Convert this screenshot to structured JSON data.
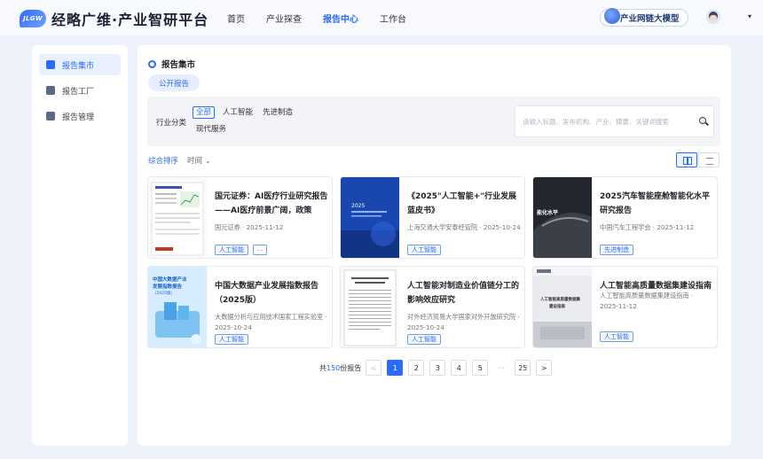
{
  "header": {
    "logo_mark": "JLGW",
    "title": "经略广维·产业智研平台",
    "nav": [
      "首页",
      "产业探查",
      "报告中心",
      "工作台"
    ],
    "ai_model": "产业网链大模型",
    "caret": "▾"
  },
  "sidebar": {
    "items": [
      {
        "label": "报告集市",
        "active": true
      },
      {
        "label": "报告工厂",
        "active": false
      },
      {
        "label": "报告管理",
        "active": false
      }
    ]
  },
  "main": {
    "title": "报告集市",
    "tab": "公开报告",
    "filter": {
      "label": "行业分类",
      "chips": [
        "全部",
        "人工智能",
        "先进制造",
        "现代服务"
      ]
    },
    "search_placeholder": "请输入标题、发布机构、产业、摘要、关键词搜索",
    "sort": {
      "primary": "综合排序",
      "secondary": "时间 ⌄"
    },
    "cards": [
      {
        "title": "国元证券：AI医疗行业研究报告——AI医疗前景广阔，政策助...",
        "meta": "国元证券 · 2025-11-12",
        "tag": "人工智能",
        "more": "..."
      },
      {
        "title": "《2025\"人工智能+\"行业发展蓝皮书》",
        "meta": "上海交通大学安泰经管院 · 2025-10-24",
        "tag": "人工智能"
      },
      {
        "title": "2025汽车智能座舱智能化水平研究报告",
        "meta": "中国汽车工程学会 · 2025-11-12",
        "tag": "先进制造"
      },
      {
        "title": "中国大数据产业发展指数报告（2025版）",
        "meta": "大数据分析与应用技术国家工程实验室 · 2025-10-24",
        "tag": "人工智能"
      },
      {
        "title": "人工智能对制造业价值链分工的影响效应研究",
        "meta": "对外经济贸易大学国家对外开放研究院 · 2025-10-24",
        "tag": "人工智能"
      },
      {
        "title": "人工智能高质量数据集建设指南",
        "meta": "人工智能高质量数据集建设指南 · 2025-11-12",
        "tag": "人工智能"
      }
    ],
    "pagination": {
      "total_prefix": "共",
      "total": "150",
      "total_suffix": "份报告",
      "prev": "<",
      "pages": [
        "1",
        "2",
        "3",
        "4",
        "5",
        "···",
        "25"
      ],
      "next": ">"
    }
  }
}
